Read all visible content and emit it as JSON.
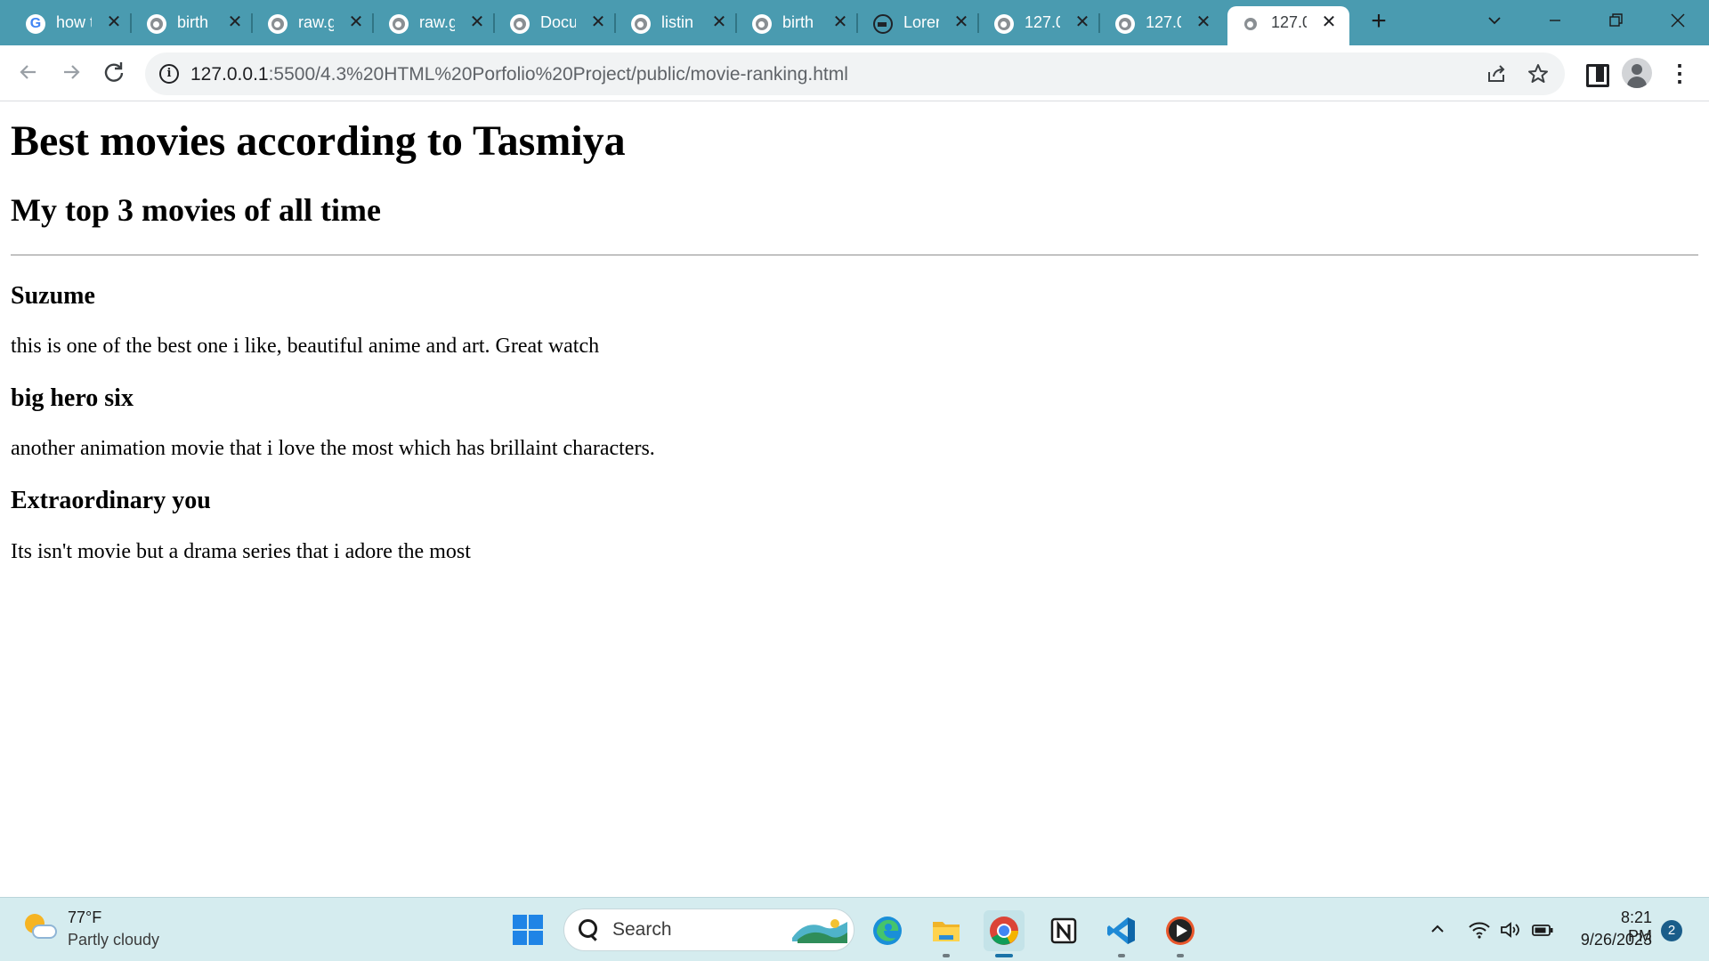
{
  "browser": {
    "tabs": [
      {
        "title": "how t",
        "favicon": "google-icon"
      },
      {
        "title": "birth",
        "favicon": "globe-icon"
      },
      {
        "title": "raw.g",
        "favicon": "globe-icon"
      },
      {
        "title": "raw.g",
        "favicon": "globe-icon"
      },
      {
        "title": "Docu",
        "favicon": "globe-icon"
      },
      {
        "title": "listin",
        "favicon": "globe-icon"
      },
      {
        "title": "birth",
        "favicon": "globe-icon"
      },
      {
        "title": "Lorer",
        "favicon": "image-icon"
      },
      {
        "title": "127.0",
        "favicon": "globe-icon"
      },
      {
        "title": "127.0",
        "favicon": "globe-icon"
      },
      {
        "title": "127.0",
        "favicon": "globe-icon",
        "active": true
      }
    ],
    "tab_close_glyph": "✕",
    "new_tab_glyph": "+",
    "address": {
      "host": "127.0.0.1",
      "path": ":5500/4.3%20HTML%20Porfolio%20Project/public/movie-ranking.html"
    }
  },
  "page": {
    "title": "Best movies according to Tasmiya",
    "subtitle": "My top 3 movies of all time",
    "movies": [
      {
        "name": "Suzume",
        "description": "this is one of the best one i like, beautiful anime and art. Great watch"
      },
      {
        "name": "big hero six",
        "description": "another animation movie that i love the most which has brillaint characters."
      },
      {
        "name": "Extraordinary you",
        "description": "Its isn't movie but a drama series that i adore the most"
      }
    ]
  },
  "taskbar": {
    "weather": {
      "temperature": "77°F",
      "condition": "Partly cloudy"
    },
    "search_label": "Search",
    "pinned_apps": [
      "edge-icon",
      "file-explorer-icon",
      "chrome-icon",
      "notion-icon",
      "vscode-icon",
      "media-player-icon"
    ],
    "clock": {
      "time": "8:21 PM",
      "date": "9/26/2023"
    },
    "notification_count": "2"
  },
  "colors": {
    "tabstrip": "#4a9bb0",
    "taskbar": "#d5ecef",
    "accent": "#1a73a8"
  }
}
